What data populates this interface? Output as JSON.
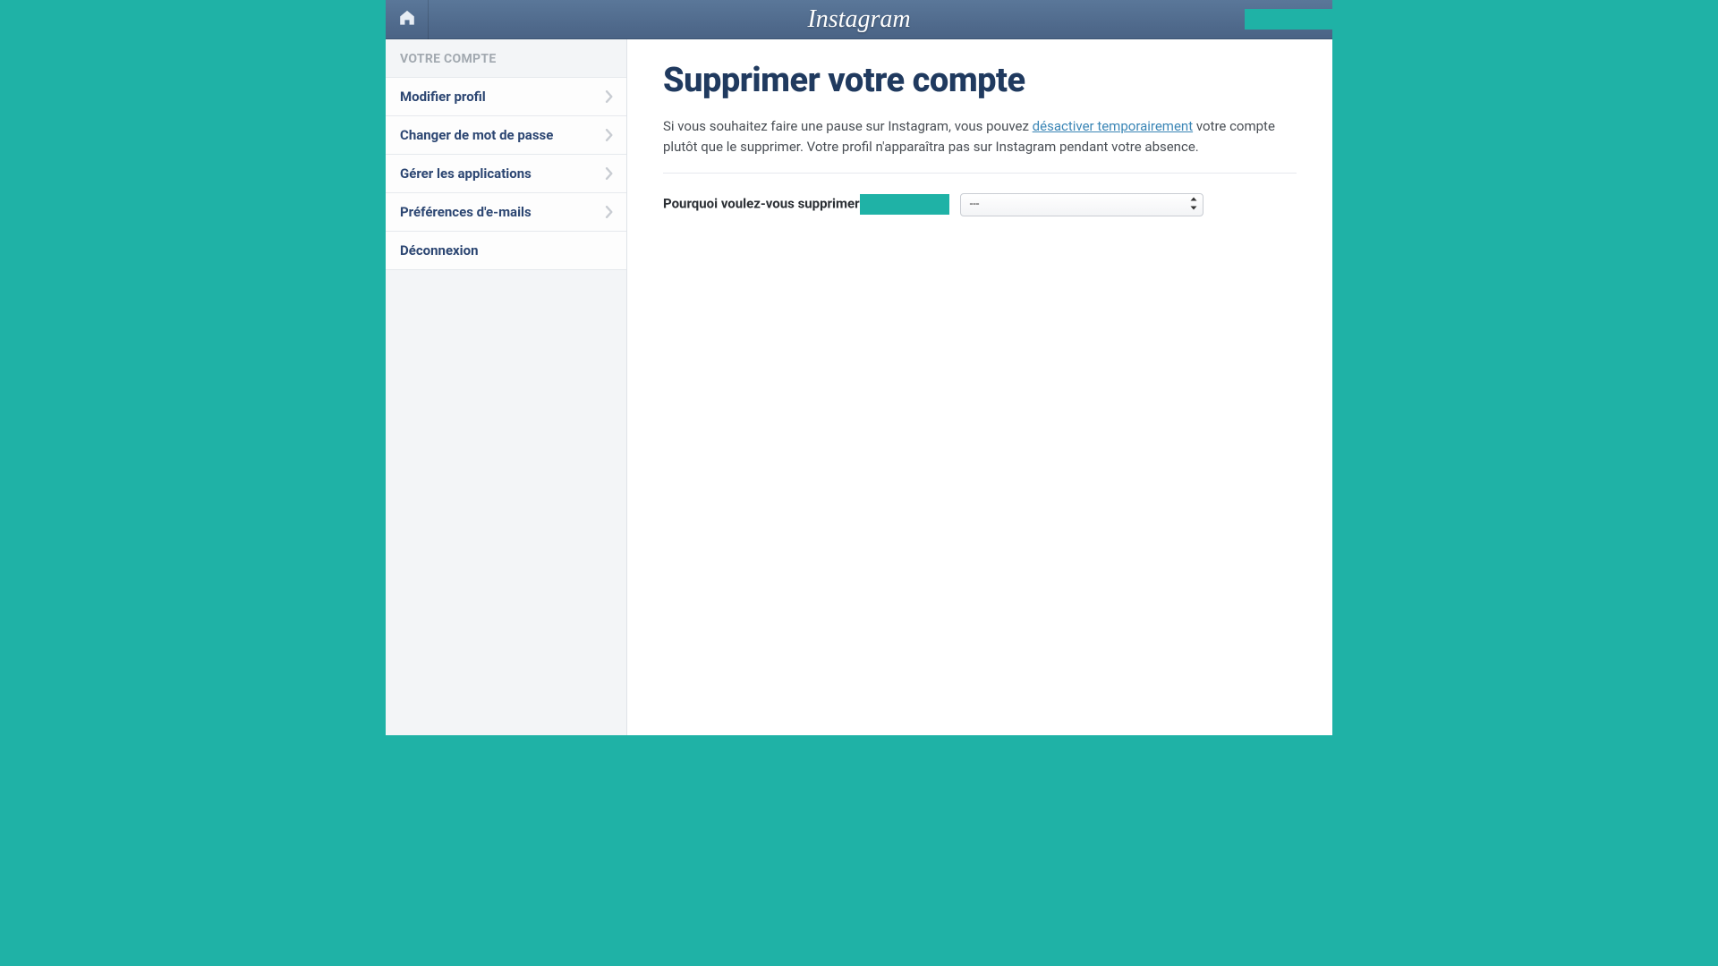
{
  "brand": {
    "name": "Instagram"
  },
  "sidebar": {
    "header": "VOTRE COMPTE",
    "items": [
      {
        "label": "Modifier profil",
        "chevron": true
      },
      {
        "label": "Changer de mot de passe",
        "chevron": true
      },
      {
        "label": "Gérer les applications",
        "chevron": true
      },
      {
        "label": "Préférences d'e-mails",
        "chevron": true
      },
      {
        "label": "Déconnexion",
        "chevron": false
      }
    ]
  },
  "main": {
    "title": "Supprimer votre compte",
    "lead_before": "Si vous souhaitez faire une pause sur Instagram, vous pouvez ",
    "lead_link": "désactiver temporairement",
    "lead_after": " votre compte plutôt que le supprimer. Votre profil n'apparaîtra pas sur Instagram pendant votre absence.",
    "question_label": "Pourquoi voulez-vous supprimer",
    "select_value": "---"
  },
  "colors": {
    "accent": "#1fb2a6",
    "header_bg": "#4f6c8f",
    "title": "#203a5f",
    "link": "#3b86b6"
  }
}
